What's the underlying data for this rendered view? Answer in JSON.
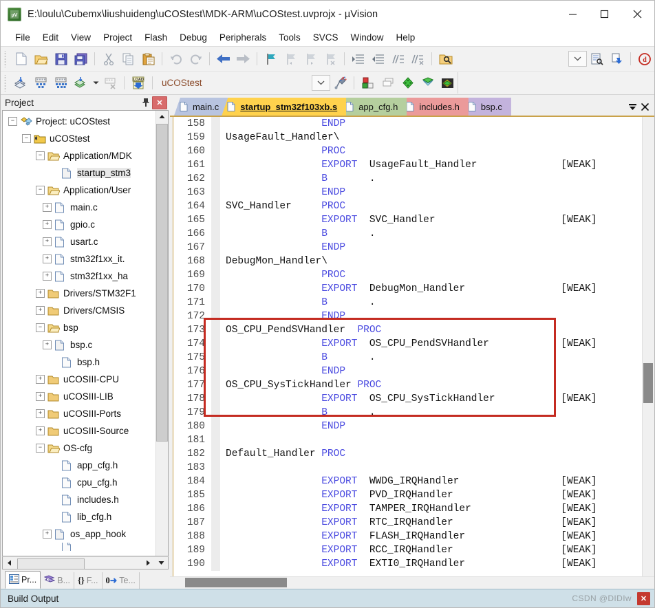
{
  "window": {
    "title": "E:\\loulu\\Cubemx\\liushuideng\\uCOStest\\MDK-ARM\\uCOStest.uvprojx - µVision",
    "logo_text": "µV",
    "minimize": "─",
    "maximize": "☐",
    "close": "✕"
  },
  "menu": {
    "items": [
      "File",
      "Edit",
      "View",
      "Project",
      "Flash",
      "Debug",
      "Peripherals",
      "Tools",
      "SVCS",
      "Window",
      "Help"
    ]
  },
  "toolbar_row1": {
    "icons": [
      "new-file-icon",
      "open-file-icon",
      "save-icon",
      "save-all-icon",
      "cut-icon",
      "copy-icon",
      "paste-icon",
      "undo-icon",
      "redo-icon",
      "navigate-back-icon",
      "navigate-forward-icon",
      "bookmark-toggle-icon",
      "bookmark-prev-icon",
      "bookmark-next-icon",
      "bookmark-clear-icon",
      "indent-right-icon",
      "indent-left-icon",
      "comment-icon",
      "uncomment-icon",
      "find-in-files-icon"
    ],
    "right_icons": [
      "configure-target-icon",
      "debug-session-icon",
      "stop-debug-icon"
    ]
  },
  "toolbar_row2": {
    "icons": [
      "translate-icon",
      "build-icon",
      "rebuild-icon",
      "batch-build-icon",
      "batch-build-dropdown-icon",
      "stop-build-icon",
      "download-icon"
    ],
    "project_select_value": "uCOStest",
    "right_icons": [
      "target-options-icon",
      "manage-project-items-icon",
      "components-icon",
      "pack-installer-icon",
      "run-to-main-icon",
      "insert-breakpoint-icon",
      "manage-run-icon"
    ]
  },
  "project_pane": {
    "title": "Project",
    "pin_icon": "pin-icon",
    "close_icon": "close-icon",
    "tree": [
      {
        "label": "Project: uCOStest",
        "depth": 0,
        "expander": "-",
        "icon": "project-icon"
      },
      {
        "label": "uCOStest",
        "depth": 1,
        "expander": "-",
        "icon": "target-icon"
      },
      {
        "label": "Application/MDK",
        "depth": 2,
        "expander": "-",
        "icon": "folder-open-icon"
      },
      {
        "label": "startup_stm3",
        "depth": 3,
        "expander": "",
        "icon": "asm-file-icon",
        "selected": true
      },
      {
        "label": "Application/User",
        "depth": 2,
        "expander": "-",
        "icon": "folder-open-icon"
      },
      {
        "label": "main.c",
        "depth": 3,
        "expander": "+",
        "icon": "c-file-icon"
      },
      {
        "label": "gpio.c",
        "depth": 3,
        "expander": "+",
        "icon": "c-file-icon"
      },
      {
        "label": "usart.c",
        "depth": 3,
        "expander": "+",
        "icon": "c-file-icon"
      },
      {
        "label": "stm32f1xx_it.",
        "depth": 3,
        "expander": "+",
        "icon": "c-file-icon"
      },
      {
        "label": "stm32f1xx_ha",
        "depth": 3,
        "expander": "+",
        "icon": "c-file-icon"
      },
      {
        "label": "Drivers/STM32F1",
        "depth": 2,
        "expander": "+",
        "icon": "folder-icon"
      },
      {
        "label": "Drivers/CMSIS",
        "depth": 2,
        "expander": "+",
        "icon": "folder-icon"
      },
      {
        "label": "bsp",
        "depth": 2,
        "expander": "-",
        "icon": "folder-open-icon"
      },
      {
        "label": "bsp.c",
        "depth": 3,
        "expander": "+",
        "icon": "c-file-icon"
      },
      {
        "label": "bsp.h",
        "depth": 3,
        "expander": "",
        "icon": "h-file-icon"
      },
      {
        "label": "uCOSIII-CPU",
        "depth": 2,
        "expander": "+",
        "icon": "folder-icon"
      },
      {
        "label": "uCOSIII-LIB",
        "depth": 2,
        "expander": "+",
        "icon": "folder-icon"
      },
      {
        "label": "uCOSIII-Ports",
        "depth": 2,
        "expander": "+",
        "icon": "folder-icon"
      },
      {
        "label": "uCOSIII-Source",
        "depth": 2,
        "expander": "+",
        "icon": "folder-icon"
      },
      {
        "label": "OS-cfg",
        "depth": 2,
        "expander": "-",
        "icon": "folder-open-icon"
      },
      {
        "label": "app_cfg.h",
        "depth": 3,
        "expander": "",
        "icon": "h-file-icon"
      },
      {
        "label": "cpu_cfg.h",
        "depth": 3,
        "expander": "",
        "icon": "h-file-icon"
      },
      {
        "label": "includes.h",
        "depth": 3,
        "expander": "",
        "icon": "h-file-icon"
      },
      {
        "label": "lib_cfg.h",
        "depth": 3,
        "expander": "",
        "icon": "h-file-icon"
      },
      {
        "label": "os_app_hook",
        "depth": 3,
        "expander": "+",
        "icon": "c-file-icon"
      }
    ],
    "bottom_tabs": [
      {
        "label": "Pr...",
        "icon": "project-window-icon",
        "active": true
      },
      {
        "label": "B...",
        "icon": "books-icon",
        "active": false
      },
      {
        "label": "F...",
        "icon": "functions-icon",
        "active": false
      },
      {
        "label": "Te...",
        "icon": "templates-icon",
        "active": false
      }
    ]
  },
  "editor": {
    "tabs": [
      {
        "label": "main.c",
        "color": "#b8c4e0",
        "active": false
      },
      {
        "label": "startup_stm32f103xb.s",
        "color": "#ffd24d",
        "active": true
      },
      {
        "label": "app_cfg.h",
        "color": "#b5cf9e",
        "active": false
      },
      {
        "label": "includes.h",
        "color": "#eb9a9a",
        "active": false
      },
      {
        "label": "bsp.c",
        "color": "#c3b3dd",
        "active": false
      }
    ],
    "tab_controls": {
      "list_icon": "tab-list-icon",
      "close_icon": "close-tab-icon"
    },
    "lines": [
      {
        "n": "158",
        "segs": [
          {
            "t": "                ",
            "c": "p"
          },
          {
            "t": "ENDP",
            "c": "k"
          }
        ]
      },
      {
        "n": "159",
        "segs": [
          {
            "t": "UsageFault_Handler\\",
            "c": "p"
          }
        ]
      },
      {
        "n": "160",
        "segs": [
          {
            "t": "                ",
            "c": "p"
          },
          {
            "t": "PROC",
            "c": "k"
          }
        ]
      },
      {
        "n": "161",
        "segs": [
          {
            "t": "                ",
            "c": "p"
          },
          {
            "t": "EXPORT",
            "c": "k"
          },
          {
            "t": "  UsageFault_Handler              [WEAK]",
            "c": "p"
          }
        ]
      },
      {
        "n": "162",
        "segs": [
          {
            "t": "                ",
            "c": "p"
          },
          {
            "t": "B",
            "c": "k"
          },
          {
            "t": "       .",
            "c": "p"
          }
        ]
      },
      {
        "n": "163",
        "segs": [
          {
            "t": "                ",
            "c": "p"
          },
          {
            "t": "ENDP",
            "c": "k"
          }
        ]
      },
      {
        "n": "164",
        "segs": [
          {
            "t": "SVC_Handler     ",
            "c": "p"
          },
          {
            "t": "PROC",
            "c": "k"
          }
        ]
      },
      {
        "n": "165",
        "segs": [
          {
            "t": "                ",
            "c": "p"
          },
          {
            "t": "EXPORT",
            "c": "k"
          },
          {
            "t": "  SVC_Handler                     [WEAK]",
            "c": "p"
          }
        ]
      },
      {
        "n": "166",
        "segs": [
          {
            "t": "                ",
            "c": "p"
          },
          {
            "t": "B",
            "c": "k"
          },
          {
            "t": "       .",
            "c": "p"
          }
        ]
      },
      {
        "n": "167",
        "segs": [
          {
            "t": "                ",
            "c": "p"
          },
          {
            "t": "ENDP",
            "c": "k"
          }
        ]
      },
      {
        "n": "168",
        "segs": [
          {
            "t": "DebugMon_Handler\\",
            "c": "p"
          }
        ]
      },
      {
        "n": "169",
        "segs": [
          {
            "t": "                ",
            "c": "p"
          },
          {
            "t": "PROC",
            "c": "k"
          }
        ]
      },
      {
        "n": "170",
        "segs": [
          {
            "t": "                ",
            "c": "p"
          },
          {
            "t": "EXPORT",
            "c": "k"
          },
          {
            "t": "  DebugMon_Handler                [WEAK]",
            "c": "p"
          }
        ]
      },
      {
        "n": "171",
        "segs": [
          {
            "t": "                ",
            "c": "p"
          },
          {
            "t": "B",
            "c": "k"
          },
          {
            "t": "       .",
            "c": "p"
          }
        ]
      },
      {
        "n": "172",
        "segs": [
          {
            "t": "                ",
            "c": "p"
          },
          {
            "t": "ENDP",
            "c": "k"
          }
        ]
      },
      {
        "n": "173",
        "segs": [
          {
            "t": "OS_CPU_PendSVHandler  ",
            "c": "p"
          },
          {
            "t": "PROC",
            "c": "k"
          }
        ]
      },
      {
        "n": "174",
        "segs": [
          {
            "t": "                ",
            "c": "p"
          },
          {
            "t": "EXPORT",
            "c": "k"
          },
          {
            "t": "  OS_CPU_PendSVHandler            [WEAK]",
            "c": "p"
          }
        ]
      },
      {
        "n": "175",
        "segs": [
          {
            "t": "                ",
            "c": "p"
          },
          {
            "t": "B",
            "c": "k"
          },
          {
            "t": "       .",
            "c": "p"
          }
        ]
      },
      {
        "n": "176",
        "segs": [
          {
            "t": "                ",
            "c": "p"
          },
          {
            "t": "ENDP",
            "c": "k"
          }
        ]
      },
      {
        "n": "177",
        "segs": [
          {
            "t": "OS_CPU_SysTickHandler ",
            "c": "p"
          },
          {
            "t": "PROC",
            "c": "k"
          }
        ]
      },
      {
        "n": "178",
        "segs": [
          {
            "t": "                ",
            "c": "p"
          },
          {
            "t": "EXPORT",
            "c": "k"
          },
          {
            "t": "  OS_CPU_SysTickHandler           [WEAK]",
            "c": "p"
          }
        ]
      },
      {
        "n": "179",
        "segs": [
          {
            "t": "                ",
            "c": "p"
          },
          {
            "t": "B",
            "c": "k"
          },
          {
            "t": "       .",
            "c": "p"
          }
        ]
      },
      {
        "n": "180",
        "segs": [
          {
            "t": "                ",
            "c": "p"
          },
          {
            "t": "ENDP",
            "c": "k"
          }
        ]
      },
      {
        "n": "181",
        "segs": [
          {
            "t": "",
            "c": "p"
          }
        ]
      },
      {
        "n": "182",
        "segs": [
          {
            "t": "Default_Handler ",
            "c": "p"
          },
          {
            "t": "PROC",
            "c": "k"
          }
        ]
      },
      {
        "n": "183",
        "segs": [
          {
            "t": "",
            "c": "p"
          }
        ]
      },
      {
        "n": "184",
        "segs": [
          {
            "t": "                ",
            "c": "p"
          },
          {
            "t": "EXPORT",
            "c": "k"
          },
          {
            "t": "  WWDG_IRQHandler                 [WEAK]",
            "c": "p"
          }
        ]
      },
      {
        "n": "185",
        "segs": [
          {
            "t": "                ",
            "c": "p"
          },
          {
            "t": "EXPORT",
            "c": "k"
          },
          {
            "t": "  PVD_IRQHandler                  [WEAK]",
            "c": "p"
          }
        ]
      },
      {
        "n": "186",
        "segs": [
          {
            "t": "                ",
            "c": "p"
          },
          {
            "t": "EXPORT",
            "c": "k"
          },
          {
            "t": "  TAMPER_IRQHandler               [WEAK]",
            "c": "p"
          }
        ]
      },
      {
        "n": "187",
        "segs": [
          {
            "t": "                ",
            "c": "p"
          },
          {
            "t": "EXPORT",
            "c": "k"
          },
          {
            "t": "  RTC_IRQHandler                  [WEAK]",
            "c": "p"
          }
        ]
      },
      {
        "n": "188",
        "segs": [
          {
            "t": "                ",
            "c": "p"
          },
          {
            "t": "EXPORT",
            "c": "k"
          },
          {
            "t": "  FLASH_IRQHandler                [WEAK]",
            "c": "p"
          }
        ]
      },
      {
        "n": "189",
        "segs": [
          {
            "t": "                ",
            "c": "p"
          },
          {
            "t": "EXPORT",
            "c": "k"
          },
          {
            "t": "  RCC_IRQHandler                  [WEAK]",
            "c": "p"
          }
        ]
      },
      {
        "n": "190",
        "segs": [
          {
            "t": "                ",
            "c": "p"
          },
          {
            "t": "EXPORT",
            "c": "k"
          },
          {
            "t": "  EXTI0_IRQHandler                [WEAK]",
            "c": "p"
          }
        ]
      }
    ],
    "annotation": {
      "name": "red-highlight-box",
      "first_line": "173",
      "last_line": "179",
      "color": "#c42b21"
    }
  },
  "status": {
    "label": "Build Output",
    "watermark": "CSDN @DIDIw",
    "close_icon": "close-icon"
  },
  "colors": {
    "keyword": "#4a4ae0",
    "accent_tab": "#ffd24d",
    "status_bg": "#cfe0e8",
    "annotation": "#c42b21"
  }
}
